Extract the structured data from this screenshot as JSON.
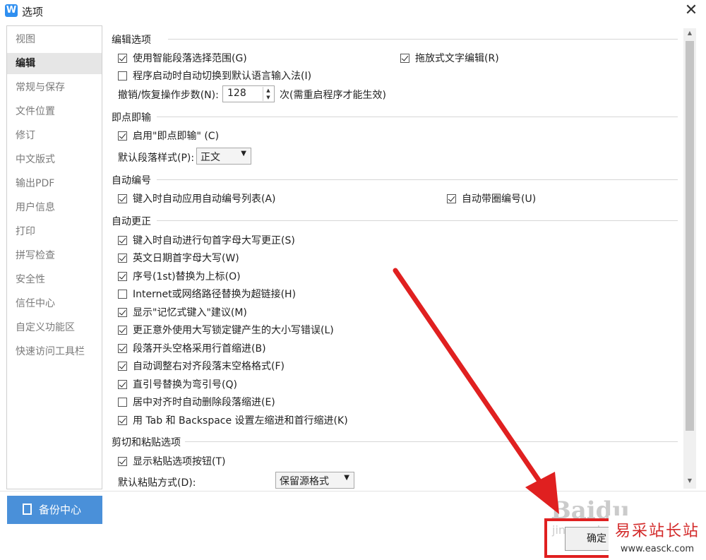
{
  "window": {
    "title": "选项",
    "close_glyph": "✕",
    "logo_letter": "W"
  },
  "sidebar": {
    "items": [
      {
        "label": "视图"
      },
      {
        "label": "编辑",
        "active": true
      },
      {
        "label": "常规与保存"
      },
      {
        "label": "文件位置"
      },
      {
        "label": "修订"
      },
      {
        "label": "中文版式"
      },
      {
        "label": "输出PDF"
      },
      {
        "label": "用户信息"
      },
      {
        "label": "打印"
      },
      {
        "label": "拼写检查"
      },
      {
        "label": "安全性"
      },
      {
        "label": "信任中心"
      },
      {
        "label": "自定义功能区"
      },
      {
        "label": "快速访问工具栏"
      }
    ],
    "backup_button": "备份中心"
  },
  "sections": {
    "edit": {
      "title": "编辑选项",
      "smart_select": {
        "label": "使用智能段落选择范围(G)",
        "checked": true
      },
      "drag_edit": {
        "label": "拖放式文字编辑(R)",
        "checked": true
      },
      "auto_ime": {
        "label": "程序启动时自动切换到默认语言输入法(I)",
        "checked": false
      },
      "undo_label": "撤销/恢复操作步数(N):",
      "undo_value": "128",
      "undo_suffix": "次(需重启程序才能生效)"
    },
    "click_type": {
      "title": "即点即输",
      "enable": {
        "label": "启用\"即点即输\" (C)",
        "checked": true
      },
      "default_style_label": "默认段落样式(P):",
      "default_style_value": "正文"
    },
    "auto_number": {
      "title": "自动编号",
      "apply_list": {
        "label": "键入时自动应用自动编号列表(A)",
        "checked": true
      },
      "circle_number": {
        "label": "自动带圈编号(U)",
        "checked": true
      }
    },
    "auto_correct": {
      "title": "自动更正",
      "items": [
        {
          "label": "键入时自动进行句首字母大写更正(S)",
          "checked": true
        },
        {
          "label": "英文日期首字母大写(W)",
          "checked": true
        },
        {
          "label": "序号(1st)替换为上标(O)",
          "checked": true
        },
        {
          "label": "Internet或网络路径替换为超链接(H)",
          "checked": false
        },
        {
          "label": "显示\"记忆式键入\"建议(M)",
          "checked": true
        },
        {
          "label": "更正意外使用大写锁定键产生的大小写错误(L)",
          "checked": true
        },
        {
          "label": "段落开头空格采用行首缩进(B)",
          "checked": true
        },
        {
          "label": "自动调整右对齐段落末空格格式(F)",
          "checked": true
        },
        {
          "label": "直引号替换为弯引号(Q)",
          "checked": true
        },
        {
          "label": "居中对齐时自动删除段落缩进(E)",
          "checked": false
        },
        {
          "label": "用 Tab 和 Backspace 设置左缩进和首行缩进(K)",
          "checked": true
        }
      ]
    },
    "paste": {
      "title": "剪切和粘贴选项",
      "show_button": {
        "label": "显示粘贴选项按钮(T)",
        "checked": true
      },
      "default_paste_label": "默认粘贴方式(D):",
      "default_paste_value": "保留源格式"
    }
  },
  "footer": {
    "ok_label": "确定"
  },
  "overlay": {
    "watermark": "Baidu",
    "watermark_sub": "jingyan.baidu",
    "badge_title": "易采站长站",
    "badge_url": "www.easck.com",
    "arrow_color": "#e02020"
  },
  "colors": {
    "accent": "#4a90d9",
    "annotation": "#e02020"
  }
}
